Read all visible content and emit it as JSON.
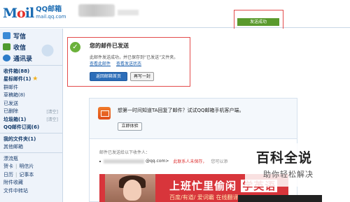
{
  "header": {
    "logo_main": "Mail",
    "logo_cn": "QQ邮箱",
    "logo_url": "mail.qq.com"
  },
  "toast": {
    "text": "发送成功"
  },
  "sidebar": {
    "write": "写信",
    "receive": "收信",
    "contacts": "通讯录",
    "items": [
      {
        "label": "收件箱(88)",
        "aux": "",
        "bold": true
      },
      {
        "label": "星标邮件(1)",
        "aux": "",
        "bold": true,
        "star": "★"
      },
      {
        "label": "群邮件",
        "aux": ""
      },
      {
        "label": "草稿箱(8)",
        "aux": ""
      },
      {
        "label": "已发送",
        "aux": ""
      },
      {
        "label": "已删除",
        "aux": "[清空]"
      },
      {
        "label": "垃圾箱(1)",
        "aux": "[清空]"
      },
      {
        "label": "QQ邮件订阅(6)",
        "aux": "",
        "bold": true
      }
    ],
    "folders_title": "我的文件夹(1)",
    "other_mailbox": "其他邮箱",
    "tools_title": "漂流瓶",
    "row1": [
      "贺卡",
      "明信片"
    ],
    "row2": [
      "日历",
      "记事本"
    ],
    "attachment_favorites": "附件收藏",
    "file_transfer": "文件中转站"
  },
  "success": {
    "title": "您的邮件已发送",
    "desc": "此邮件发送成功，并已保存到“已发送”文件夹。",
    "link_view": "查看此邮件",
    "link_status": "查看发送状态",
    "btn_home": "返回邮箱首页",
    "btn_again": "再写一封"
  },
  "promo": {
    "text": "想第一时间知道TA回复了邮件？试试QQ邮箱手机客户端。",
    "btn_try": "立即体验",
    "sent_label": "邮件已发送给以下收件人：",
    "recipient_suffix": "@qq.com>",
    "warn": "此联系人未保存，",
    "hint": "您可以添"
  },
  "banner": {
    "title_a": "上班忙里偷闲",
    "title_b": "学英语",
    "sub": "百度/有道/ 爱词霸 在线翻译"
  },
  "watermark": {
    "title": "百科全说",
    "sub": "助你轻松解决"
  }
}
